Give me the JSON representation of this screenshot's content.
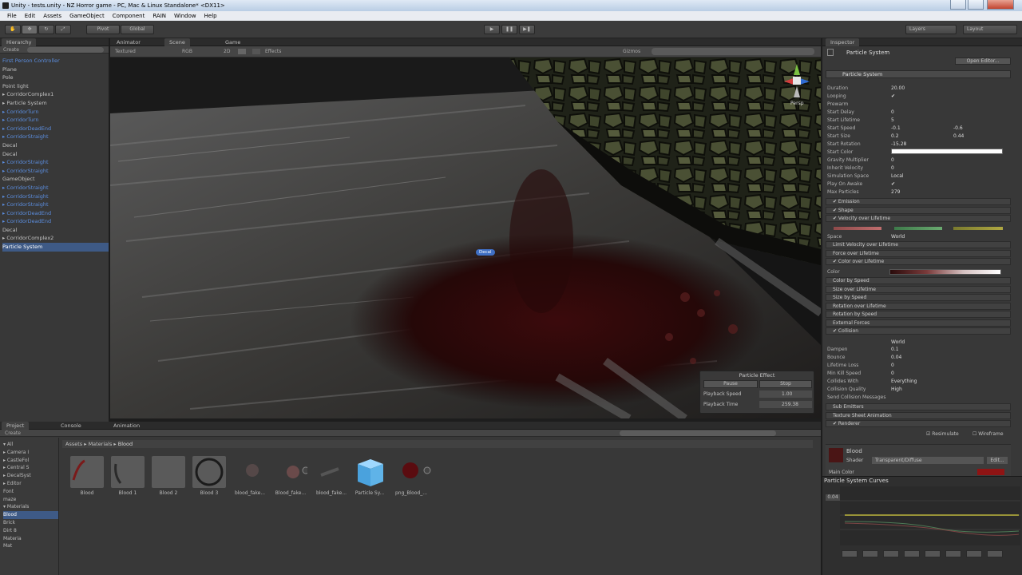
{
  "window": {
    "title": "Unity - tests.unity - NZ Horror game - PC, Mac & Linux Standalone* <DX11>"
  },
  "menu": [
    "File",
    "Edit",
    "Assets",
    "GameObject",
    "Component",
    "RAIN",
    "Window",
    "Help"
  ],
  "toolbar": {
    "pivot": "Pivot",
    "global": "Global",
    "layers": "Layers",
    "layout": "Layout"
  },
  "tabs": {
    "hierarchy": "Hierarchy",
    "animator": "Animator",
    "scene": "Scene",
    "game": "Game",
    "inspector": "Inspector",
    "project": "Project",
    "console": "Console",
    "animation": "Animation"
  },
  "hierarchy": {
    "create": "Create",
    "items": [
      {
        "label": "First Person Controller",
        "style": "blue"
      },
      {
        "label": "Plane",
        "style": ""
      },
      {
        "label": "Pole",
        "style": ""
      },
      {
        "label": "Point light",
        "style": ""
      },
      {
        "label": "▸ CorridorComplex1",
        "style": ""
      },
      {
        "label": "  ▸ Particle System",
        "style": ""
      },
      {
        "label": "  ▸ CorridorTurn",
        "style": "blue"
      },
      {
        "label": "  ▸ CorridorTurn",
        "style": "blue"
      },
      {
        "label": "  ▸ CorridorDeadEnd",
        "style": "blue"
      },
      {
        "label": "  ▸ CorridorStraight",
        "style": "blue"
      },
      {
        "label": "    Decal",
        "style": ""
      },
      {
        "label": "    Decal",
        "style": ""
      },
      {
        "label": "  ▸ CorridorStraight",
        "style": "blue"
      },
      {
        "label": "  ▸ CorridorStraight",
        "style": "blue"
      },
      {
        "label": "    GameObject",
        "style": ""
      },
      {
        "label": "  ▸ CorridorStraight",
        "style": "blue"
      },
      {
        "label": "  ▸ CorridorStraight",
        "style": "blue"
      },
      {
        "label": "  ▸ CorridorStraight",
        "style": "blue"
      },
      {
        "label": "  ▸ CorridorDeadEnd",
        "style": "blue"
      },
      {
        "label": "  ▸ CorridorDeadEnd",
        "style": "blue"
      },
      {
        "label": "    Decal",
        "style": ""
      },
      {
        "label": "▸ CorridorComplex2",
        "style": ""
      },
      {
        "label": "Particle System",
        "style": "sel"
      }
    ]
  },
  "sceneview": {
    "textured": "Textured",
    "rgb": "RGB",
    "twod": "2D",
    "effects": "Effects",
    "gizmos": "Gizmos",
    "persp": "Persp",
    "decal_label": "Decal"
  },
  "particle_effect": {
    "title": "Particle Effect",
    "pause": "Pause",
    "stop": "Stop",
    "speed_label": "Playback Speed",
    "speed_value": "1.00",
    "time_label": "Playback Time",
    "time_value": "259.38"
  },
  "inspector": {
    "object_name": "Particle System",
    "open_editor": "Open Editor...",
    "section_title": "Particle System",
    "props": [
      {
        "k": "Duration",
        "v": "20.00",
        "v2": ""
      },
      {
        "k": "Looping",
        "v": "✔",
        "v2": ""
      },
      {
        "k": "Prewarm",
        "v": "",
        "v2": ""
      },
      {
        "k": "Start Delay",
        "v": "0",
        "v2": ""
      },
      {
        "k": "Start Lifetime",
        "v": "5",
        "v2": ""
      },
      {
        "k": "Start Speed",
        "v": "-0.1",
        "v2": "-0.6"
      },
      {
        "k": "Start Size",
        "v": "0.2",
        "v2": "0.44"
      },
      {
        "k": "Start Rotation",
        "v": "-15.28",
        "v2": ""
      },
      {
        "k": "Start Color",
        "v": "",
        "v2": ""
      },
      {
        "k": "Gravity Multiplier",
        "v": "0",
        "v2": ""
      },
      {
        "k": "Inherit Velocity",
        "v": "0",
        "v2": ""
      },
      {
        "k": "Simulation Space",
        "v": "Local",
        "v2": ""
      },
      {
        "k": "Play On Awake",
        "v": "✔",
        "v2": ""
      },
      {
        "k": "Max Particles",
        "v": "279",
        "v2": ""
      }
    ],
    "modules_a": [
      "✔ Emission",
      "✔ Shape",
      "✔ Velocity over Lifetime"
    ],
    "space_label": "Space",
    "space_value": "World",
    "modules_b": [
      "Limit Velocity over Lifetime",
      "Force over Lifetime",
      "✔ Color over Lifetime"
    ],
    "color_label": "Color",
    "modules_c": [
      "Color by Speed",
      "Size over Lifetime",
      "Size by Speed",
      "Rotation over Lifetime",
      "Rotation by Speed",
      "External Forces",
      "✔ Collision"
    ],
    "collision_space": "World",
    "collision_props": [
      {
        "k": "Dampen",
        "v": "0.1"
      },
      {
        "k": "Bounce",
        "v": "0.04"
      },
      {
        "k": "Lifetime Loss",
        "v": "0"
      },
      {
        "k": "Min Kill Speed",
        "v": "0"
      },
      {
        "k": "Collides With",
        "v": "Everything"
      },
      {
        "k": "Collision Quality",
        "v": "High"
      },
      {
        "k": "Send Collision Messages",
        "v": ""
      }
    ],
    "modules_d": [
      "Sub Emitters",
      "Texture Sheet Animation",
      "✔ Renderer"
    ],
    "resimulate": "Resimulate",
    "wireframe": "Wireframe",
    "material_name": "Blood",
    "shader_label": "Shader",
    "shader_value": "Transparent/Diffuse",
    "edit_btn": "Edit...",
    "main_color_label": "Main Color",
    "curves_title": "Particle System Curves",
    "curve_value": "0.04"
  },
  "project": {
    "create": "Create",
    "breadcrumb": [
      "Assets",
      "Materials",
      "Blood"
    ],
    "tree": [
      {
        "label": "▾ All",
        "sel": false
      },
      {
        "label": "  ▸ Camera I",
        "sel": false
      },
      {
        "label": "  ▸ CastleFol",
        "sel": false
      },
      {
        "label": "  ▸ Central S",
        "sel": false
      },
      {
        "label": "  ▸ DecalSyst",
        "sel": false
      },
      {
        "label": "  ▸ Editor",
        "sel": false
      },
      {
        "label": "    Font",
        "sel": false
      },
      {
        "label": "    maze",
        "sel": false
      },
      {
        "label": "  ▾ Materials",
        "sel": false
      },
      {
        "label": "      Blood",
        "sel": true
      },
      {
        "label": "      Brick",
        "sel": false
      },
      {
        "label": "      Dirt 8",
        "sel": false
      },
      {
        "label": "      Materia",
        "sel": false
      },
      {
        "label": "      Mat",
        "sel": false
      }
    ],
    "assets": [
      "Blood",
      "Blood 1",
      "Blood 2",
      "Blood 3",
      "blood_fake...",
      "Blood_fake...",
      "blood_fake...",
      "Particle Sy...",
      "png_Blood_..."
    ]
  },
  "colors": {
    "accent": "#3e5a86",
    "blood": "#5a0c10",
    "cube": "#5fb3e8"
  }
}
